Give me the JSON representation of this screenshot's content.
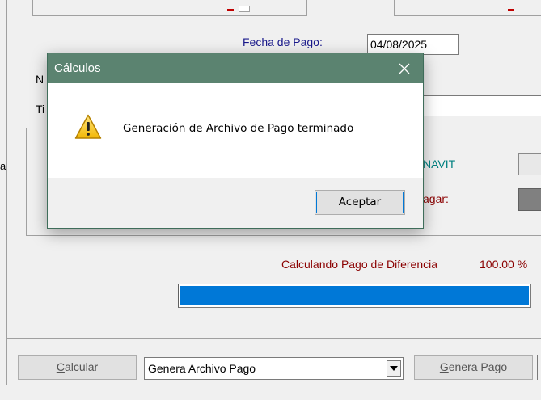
{
  "form": {
    "fecha_label": "Fecha de Pago:",
    "fecha_value": "04/08/2025",
    "left_clip_n": "N",
    "left_clip_ti": "Ti",
    "left_clip_a": "a",
    "infonavit_label": "NAVIT",
    "pagar_label": "agar:",
    "progress_label": "Calculando Pago de Diferencia",
    "progress_percent": "100.00 %",
    "progress_value": 1.0
  },
  "footer": {
    "calcular": {
      "accel": "C",
      "rest": "alcular"
    },
    "combo_value": "Genera Archivo Pago",
    "genera_pago": {
      "accel": "G",
      "rest": "enera Pago"
    }
  },
  "dialog": {
    "title": "Cálculos",
    "message": "Generación de Archivo de Pago terminado",
    "ok_label": "Aceptar",
    "icon": "warning-icon",
    "close_icon": "close-icon"
  },
  "colors": {
    "titlebar": "#5b8370",
    "progress_fill": "#0078d7",
    "label_blue": "#1a1a8c",
    "label_teal": "#008080",
    "label_red": "#8b0000"
  }
}
